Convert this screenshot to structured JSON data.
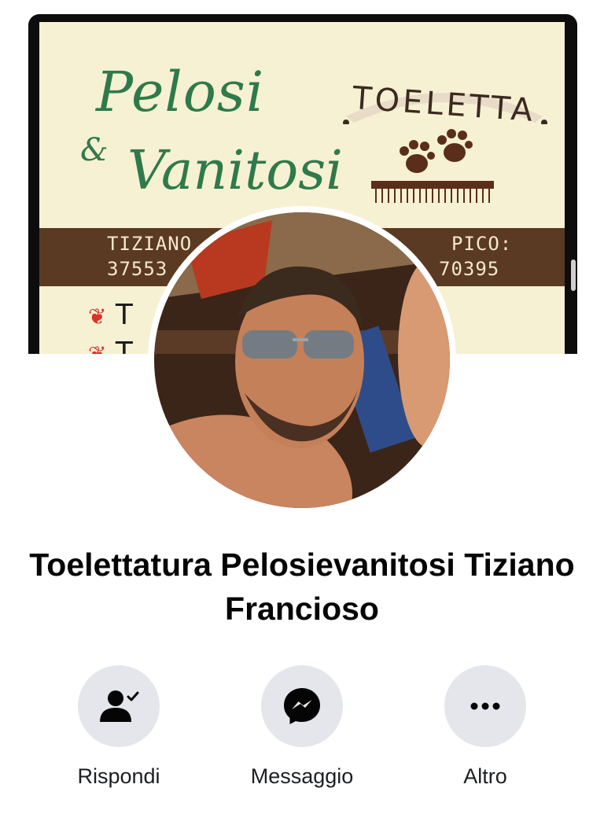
{
  "cover": {
    "logo_line1": "Pelosi",
    "logo_amp": "&",
    "logo_line2": "Vanitosi",
    "banner": "TOELETTA",
    "contact_left_name": "TIZIANO",
    "contact_left_phone": "37553",
    "contact_right_label": "PICO:",
    "contact_right_phone": "70395",
    "bullet_1": "T",
    "bullet_2": "T"
  },
  "profile": {
    "name": "Toelettatura Pelosievanitosi Tiziano Francioso"
  },
  "actions": [
    {
      "label": "Rispondi",
      "icon": "person-check-icon"
    },
    {
      "label": "Messaggio",
      "icon": "messenger-icon"
    },
    {
      "label": "Altro",
      "icon": "more-dots-icon"
    }
  ],
  "colors": {
    "action_bg": "#e4e6eb",
    "logo_green": "#2f7a4b",
    "strip_brown": "#5a3a22",
    "cover_bg": "#f7f1d3"
  }
}
